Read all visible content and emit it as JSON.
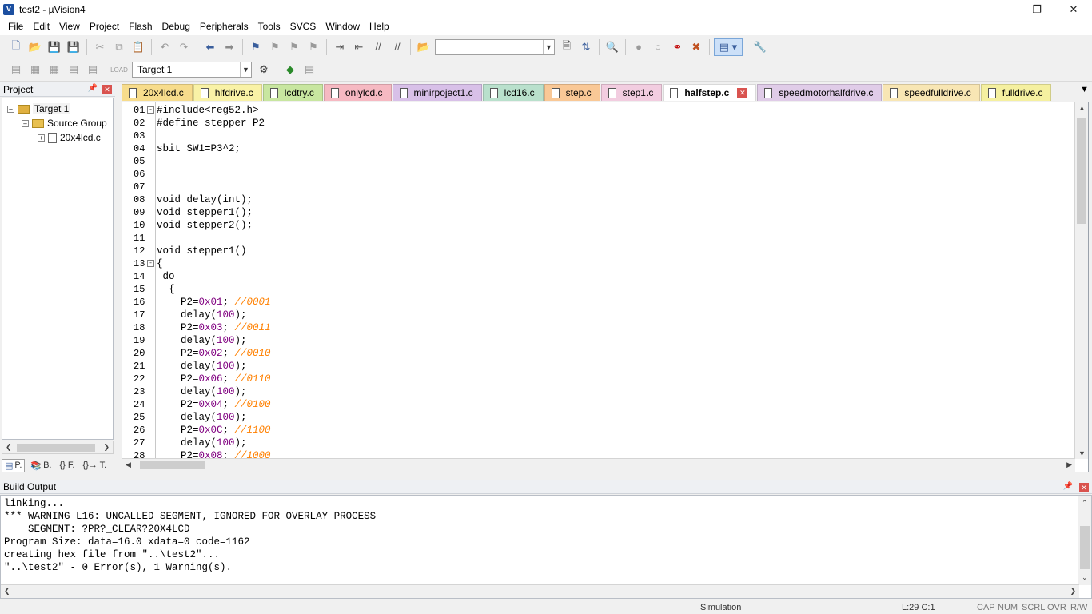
{
  "window": {
    "title": "test2  - µVision4",
    "app_icon": "V",
    "controls": [
      "minimize-icon",
      "restore-icon",
      "close-icon"
    ]
  },
  "menu": [
    "File",
    "Edit",
    "View",
    "Project",
    "Flash",
    "Debug",
    "Peripherals",
    "Tools",
    "SVCS",
    "Window",
    "Help"
  ],
  "toolbar2": {
    "target_select": "Target 1"
  },
  "project_pane": {
    "title": "Project",
    "tree": {
      "target": "Target 1",
      "group": "Source Group",
      "file": "20x4lcd.c"
    },
    "tabs": [
      "P.",
      "B.",
      "{} F.",
      "{}→ T."
    ]
  },
  "file_tabs": [
    {
      "name": "20x4lcd.c",
      "color": "#f7dc8c"
    },
    {
      "name": "hlfdrive.c",
      "color": "#f9f2a6"
    },
    {
      "name": "lcdtry.c",
      "color": "#c8e6a0"
    },
    {
      "name": "onlylcd.c",
      "color": "#f6b9c2"
    },
    {
      "name": "minirpoject1.c",
      "color": "#d8c0e8"
    },
    {
      "name": "lcd16.c",
      "color": "#b9e0cc"
    },
    {
      "name": "step.c",
      "color": "#f9c896"
    },
    {
      "name": "step1.c",
      "color": "#f2cde0"
    },
    {
      "name": "halfstep.c",
      "color": "#ffffff",
      "active": true
    },
    {
      "name": "speedmotorhalfdrive.c",
      "color": "#e0cce8"
    },
    {
      "name": "speedfulldrive.c",
      "color": "#f8e6b4"
    },
    {
      "name": "fulldrive.c",
      "color": "#f5f0a0"
    }
  ],
  "editor": {
    "lines": [
      {
        "n": "01",
        "fold": "-",
        "segs": [
          [
            "",
            "#include<reg52.h>"
          ]
        ]
      },
      {
        "n": "02",
        "segs": [
          [
            "",
            "#define stepper P2"
          ]
        ]
      },
      {
        "n": "03",
        "segs": []
      },
      {
        "n": "04",
        "segs": [
          [
            "",
            "sbit SW1=P3^2;"
          ]
        ]
      },
      {
        "n": "05",
        "segs": []
      },
      {
        "n": "06",
        "segs": []
      },
      {
        "n": "07",
        "segs": []
      },
      {
        "n": "08",
        "segs": [
          [
            "",
            "void delay(int);"
          ]
        ]
      },
      {
        "n": "09",
        "segs": [
          [
            "",
            "void stepper1();"
          ]
        ]
      },
      {
        "n": "10",
        "segs": [
          [
            "",
            "void stepper2();"
          ]
        ]
      },
      {
        "n": "11",
        "segs": []
      },
      {
        "n": "12",
        "segs": [
          [
            "",
            "void stepper1()"
          ]
        ]
      },
      {
        "n": "13",
        "fold": "-",
        "segs": [
          [
            "",
            "{"
          ]
        ]
      },
      {
        "n": "14",
        "segs": [
          [
            "",
            " do"
          ]
        ]
      },
      {
        "n": "15",
        "segs": [
          [
            "",
            "  {"
          ]
        ]
      },
      {
        "n": "16",
        "segs": [
          [
            "",
            "    P2="
          ],
          [
            "num",
            "0x01"
          ],
          [
            "",
            "; "
          ],
          [
            "cmt",
            "//0001"
          ]
        ]
      },
      {
        "n": "17",
        "segs": [
          [
            "",
            "    delay("
          ],
          [
            "num",
            "100"
          ],
          [
            "",
            ");"
          ]
        ]
      },
      {
        "n": "18",
        "segs": [
          [
            "",
            "    P2="
          ],
          [
            "num",
            "0x03"
          ],
          [
            "",
            "; "
          ],
          [
            "cmt",
            "//0011"
          ]
        ]
      },
      {
        "n": "19",
        "segs": [
          [
            "",
            "    delay("
          ],
          [
            "num",
            "100"
          ],
          [
            "",
            ");"
          ]
        ]
      },
      {
        "n": "20",
        "segs": [
          [
            "",
            "    P2="
          ],
          [
            "num",
            "0x02"
          ],
          [
            "",
            "; "
          ],
          [
            "cmt",
            "//0010"
          ]
        ]
      },
      {
        "n": "21",
        "segs": [
          [
            "",
            "    delay("
          ],
          [
            "num",
            "100"
          ],
          [
            "",
            ");"
          ]
        ]
      },
      {
        "n": "22",
        "segs": [
          [
            "",
            "    P2="
          ],
          [
            "num",
            "0x06"
          ],
          [
            "",
            "; "
          ],
          [
            "cmt",
            "//0110"
          ]
        ]
      },
      {
        "n": "23",
        "segs": [
          [
            "",
            "    delay("
          ],
          [
            "num",
            "100"
          ],
          [
            "",
            ");"
          ]
        ]
      },
      {
        "n": "24",
        "segs": [
          [
            "",
            "    P2="
          ],
          [
            "num",
            "0x04"
          ],
          [
            "",
            "; "
          ],
          [
            "cmt",
            "//0100"
          ]
        ]
      },
      {
        "n": "25",
        "segs": [
          [
            "",
            "    delay("
          ],
          [
            "num",
            "100"
          ],
          [
            "",
            ");"
          ]
        ]
      },
      {
        "n": "26",
        "segs": [
          [
            "",
            "    P2="
          ],
          [
            "num",
            "0x0C"
          ],
          [
            "",
            "; "
          ],
          [
            "cmt",
            "//1100"
          ]
        ]
      },
      {
        "n": "27",
        "segs": [
          [
            "",
            "    delay("
          ],
          [
            "num",
            "100"
          ],
          [
            "",
            ");"
          ]
        ]
      },
      {
        "n": "28",
        "segs": [
          [
            "",
            "    P2="
          ],
          [
            "num",
            "0x08"
          ],
          [
            "",
            "; "
          ],
          [
            "cmt",
            "//1000"
          ]
        ]
      }
    ]
  },
  "build_output": {
    "title": "Build Output",
    "lines": [
      "linking...",
      "*** WARNING L16: UNCALLED SEGMENT, IGNORED FOR OVERLAY PROCESS",
      "    SEGMENT: ?PR?_CLEAR?20X4LCD",
      "Program Size: data=16.0 xdata=0 code=1162",
      "creating hex file from \"..\\test2\"...",
      "\"..\\test2\" - 0 Error(s), 1 Warning(s)."
    ]
  },
  "status": {
    "mode": "Simulation",
    "cursor": "L:29 C:1",
    "flags": [
      "CAP",
      "NUM",
      "SCRL",
      "OVR",
      "R/W"
    ]
  }
}
